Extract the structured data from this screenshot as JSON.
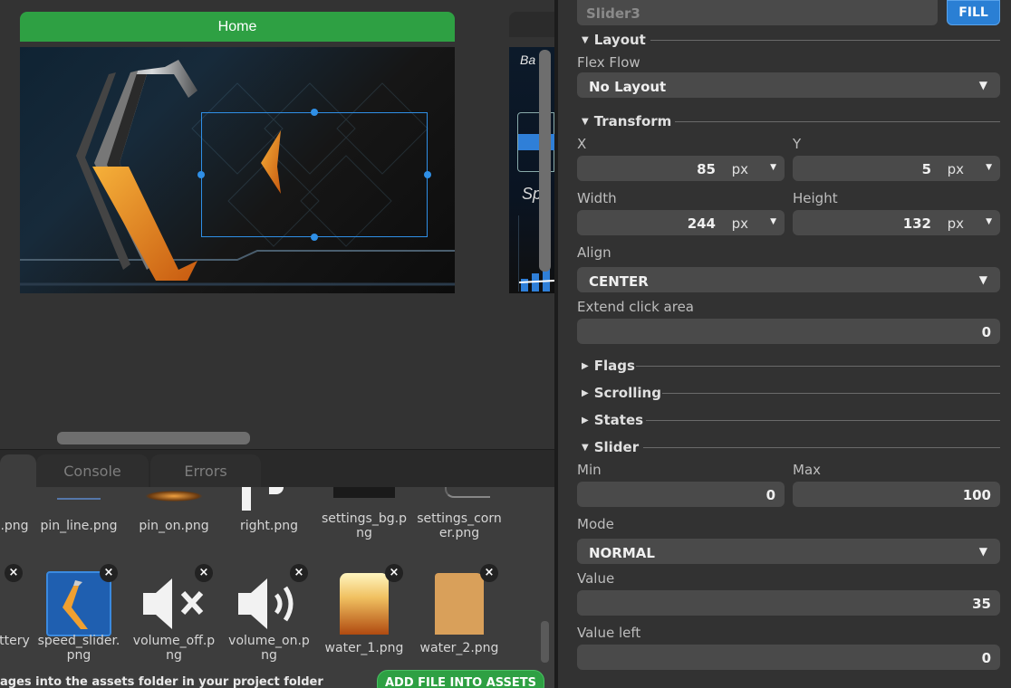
{
  "canvas": {
    "screen_title": "Home",
    "second_screen": {
      "text_top": "Ba",
      "text_mid": "Sp"
    }
  },
  "bottom_tabs": [
    {
      "label": ""
    },
    {
      "label": "Console"
    },
    {
      "label": "Errors"
    }
  ],
  "assets": {
    "row1": [
      {
        "name": ".png"
      },
      {
        "name": "pin_line.png"
      },
      {
        "name": "pin_on.png"
      },
      {
        "name": "right.png"
      },
      {
        "name": "settings_bg.p\nng"
      },
      {
        "name": "settings_corn\ner.png"
      }
    ],
    "row2": [
      {
        "name": "ttery"
      },
      {
        "name": "speed_slider.\npng"
      },
      {
        "name": "volume_off.p\nng"
      },
      {
        "name": "volume_on.p\nng"
      },
      {
        "name": "water_1.png"
      },
      {
        "name": "water_2.png"
      }
    ],
    "close_glyph": "×",
    "hint": "ages into the assets folder in your project folder",
    "add_button": "ADD FILE INTO ASSETS"
  },
  "props": {
    "name_placeholder": "Slider3",
    "fill_label": "FILL",
    "layout": {
      "title": "Layout",
      "flex_flow_label": "Flex Flow",
      "flex_flow_value": "No Layout"
    },
    "transform": {
      "title": "Transform",
      "x_label": "X",
      "x_value": "85",
      "x_unit": "px",
      "y_label": "Y",
      "y_value": "5",
      "y_unit": "px",
      "width_label": "Width",
      "width_value": "244",
      "width_unit": "px",
      "height_label": "Height",
      "height_value": "132",
      "height_unit": "px",
      "align_label": "Align",
      "align_value": "CENTER",
      "extend_label": "Extend click area",
      "extend_value": "0"
    },
    "collapsed_sections": [
      "Flags",
      "Scrolling",
      "States"
    ],
    "slider": {
      "title": "Slider",
      "min_label": "Min",
      "min_value": "0",
      "max_label": "Max",
      "max_value": "100",
      "mode_label": "Mode",
      "mode_value": "NORMAL",
      "value_label": "Value",
      "value_value": "35",
      "value_left_label": "Value left",
      "value_left_value": "0"
    }
  },
  "colors": {
    "accent_green": "#2ea043",
    "accent_blue": "#2a7fd4",
    "selection_blue": "#2f8fe6"
  }
}
